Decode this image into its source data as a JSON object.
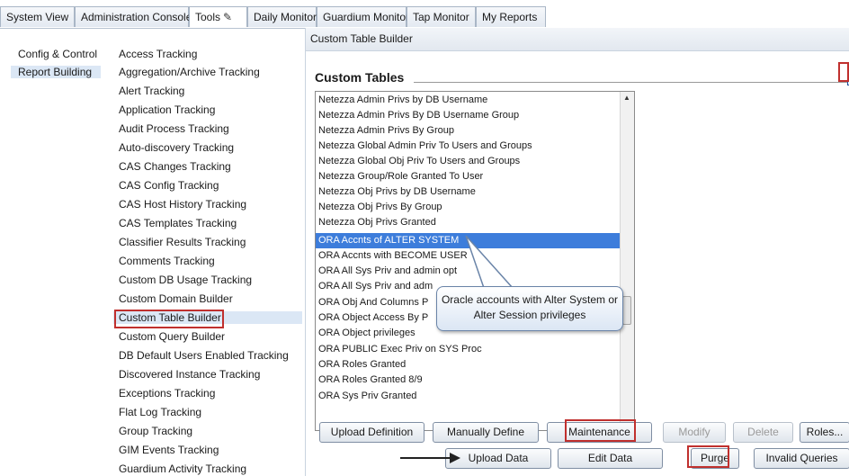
{
  "tabs": [
    {
      "label": "System View"
    },
    {
      "label": "Administration Console"
    },
    {
      "label": "Tools",
      "icon": "pencil-icon"
    },
    {
      "label": "Daily Monitor"
    },
    {
      "label": "Guardium Monitor"
    },
    {
      "label": "Tap Monitor"
    },
    {
      "label": "My Reports"
    }
  ],
  "left_nav": {
    "items": [
      {
        "label": "Config & Control"
      },
      {
        "label": "Report Building"
      }
    ]
  },
  "sub_nav": {
    "items": [
      {
        "label": "Access Tracking"
      },
      {
        "label": "Aggregation/Archive Tracking"
      },
      {
        "label": "Alert Tracking"
      },
      {
        "label": "Application Tracking"
      },
      {
        "label": "Audit Process Tracking"
      },
      {
        "label": "Auto-discovery Tracking"
      },
      {
        "label": "CAS Changes Tracking"
      },
      {
        "label": "CAS Config Tracking"
      },
      {
        "label": "CAS Host History Tracking"
      },
      {
        "label": "CAS Templates Tracking"
      },
      {
        "label": "Classifier Results Tracking"
      },
      {
        "label": "Comments Tracking"
      },
      {
        "label": "Custom DB Usage Tracking"
      },
      {
        "label": "Custom Domain Builder"
      },
      {
        "label": "Custom Table Builder"
      },
      {
        "label": "Custom Query Builder"
      },
      {
        "label": "DB Default Users Enabled Tracking"
      },
      {
        "label": "Discovered Instance Tracking"
      },
      {
        "label": "Exceptions Tracking"
      },
      {
        "label": "Flat Log Tracking"
      },
      {
        "label": "Group Tracking"
      },
      {
        "label": "GIM Events Tracking"
      },
      {
        "label": "Guardium Activity Tracking"
      }
    ]
  },
  "panel": {
    "header": "Custom Table Builder",
    "section_title": "Custom Tables",
    "help_glyph": "?",
    "tables": [
      "Netezza Admin Privs by DB Username",
      "Netezza Admin Privs By DB Username Group",
      "Netezza Admin Privs By Group",
      "Netezza Global Admin Priv To Users and Groups",
      "Netezza Global Obj Priv To Users and Groups",
      "Netezza Group/Role Granted To User",
      "Netezza Obj Privs by DB Username",
      "Netezza Obj Privs By Group",
      "Netezza Obj Privs Granted",
      "ORA Accnts of ALTER SYSTEM",
      "ORA Accnts with BECOME USER",
      "ORA All Sys Priv and admin opt",
      "ORA All Sys Priv and adm",
      "ORA Obj And Columns P",
      "ORA Object Access By P",
      "ORA Object privileges",
      "ORA PUBLIC Exec Priv on SYS Proc",
      "ORA Roles Granted",
      "ORA Roles Granted 8/9",
      "ORA Sys Priv Granted"
    ],
    "selected_table": "ORA Accnts of ALTER SYSTEM",
    "callout": "Oracle accounts with Alter System or Alter Session privileges",
    "buttons_row1": [
      {
        "label": "Upload Definition",
        "enabled": true
      },
      {
        "label": "Manually Define",
        "enabled": true
      },
      {
        "label": "Maintenance",
        "enabled": true
      },
      {
        "label": "Modify",
        "enabled": false
      },
      {
        "label": "Delete",
        "enabled": false
      },
      {
        "label": "Roles...",
        "enabled": true
      }
    ],
    "buttons_row2": [
      {
        "label": "Upload Data",
        "enabled": true
      },
      {
        "label": "Edit Data",
        "enabled": true
      },
      {
        "label": "Purge",
        "enabled": true
      },
      {
        "label": "Invalid Queries",
        "enabled": true
      }
    ]
  },
  "colors": {
    "highlight_box": "#c0302e",
    "selection": "#3d7ddb",
    "nav_selection": "#dbe7f5"
  }
}
